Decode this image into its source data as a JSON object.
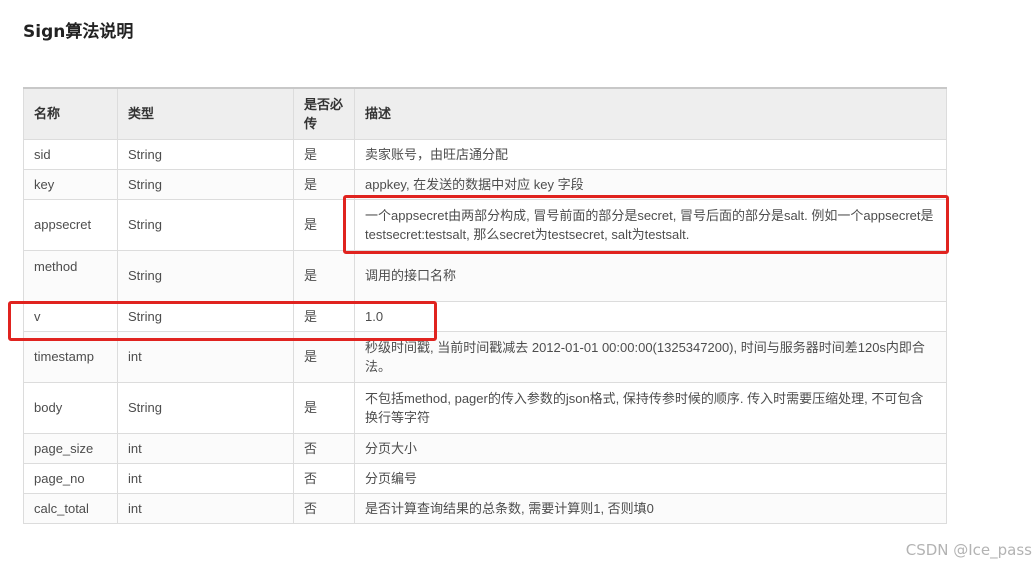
{
  "title": "Sign算法说明",
  "table": {
    "headers": {
      "name": "名称",
      "type": "类型",
      "required": "是否必传",
      "desc": "描述"
    },
    "rows": [
      {
        "name": "sid",
        "type": "String",
        "required": "是",
        "desc": "卖家账号，由旺店通分配"
      },
      {
        "name": "key",
        "type": "String",
        "required": "是",
        "desc": "appkey, 在发送的数据中对应 key 字段"
      },
      {
        "name": "appsecret",
        "type": "String",
        "required": "是",
        "desc": "一个appsecret由两部分构成, 冒号前面的部分是secret, 冒号后面的部分是salt. 例如一个appsecret是testsecret:testsalt, 那么secret为testsecret, salt为testsalt."
      },
      {
        "name": "method",
        "type": "String",
        "required": "是",
        "desc": "调用的接口名称"
      },
      {
        "name": "v",
        "type": "String",
        "required": "是",
        "desc": "1.0"
      },
      {
        "name": "timestamp",
        "type": "int",
        "required": "是",
        "desc": "秒级时间戳, 当前时间戳减去 2012-01-01 00:00:00(1325347200), 时间与服务器时间差120s内即合法。"
      },
      {
        "name": "body",
        "type": "String",
        "required": "是",
        "desc": "不包括method, pager的传入参数的json格式, 保持传参时候的顺序. 传入时需要压缩处理, 不可包含换行等字符"
      },
      {
        "name": "page_size",
        "type": "int",
        "required": "否",
        "desc": "分页大小"
      },
      {
        "name": "page_no",
        "type": "int",
        "required": "否",
        "desc": "分页编号"
      },
      {
        "name": "calc_total",
        "type": "int",
        "required": "否",
        "desc": "是否计算查询结果的总条数, 需要计算则1, 否则填0"
      }
    ]
  },
  "highlight_color": "#e0231f",
  "watermark": "CSDN @Ice_pass"
}
